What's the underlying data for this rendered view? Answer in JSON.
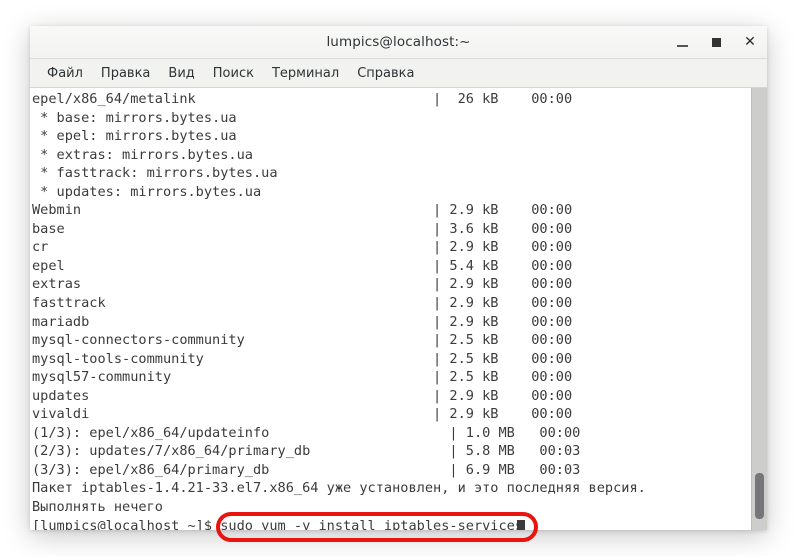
{
  "window": {
    "title": "lumpics@localhost:~",
    "controls": [
      {
        "name": "minimize",
        "glyph": "_"
      },
      {
        "name": "maximize",
        "glyph": "■"
      },
      {
        "name": "close",
        "glyph": "✕"
      }
    ]
  },
  "menubar": {
    "items": [
      {
        "label": "Файл"
      },
      {
        "label": "Правка"
      },
      {
        "label": "Вид"
      },
      {
        "label": "Поиск"
      },
      {
        "label": "Терминал"
      },
      {
        "label": "Справка"
      }
    ]
  },
  "terminal": {
    "lines": [
      "epel/x86_64/metalink                             |  26 kB    00:00",
      " * base: mirrors.bytes.ua",
      " * epel: mirrors.bytes.ua",
      " * extras: mirrors.bytes.ua",
      " * fasttrack: mirrors.bytes.ua",
      " * updates: mirrors.bytes.ua",
      "Webmin                                           | 2.9 kB    00:00",
      "base                                             | 3.6 kB    00:00",
      "cr                                               | 2.9 kB    00:00",
      "epel                                             | 5.4 kB    00:00",
      "extras                                           | 2.9 kB    00:00",
      "fasttrack                                        | 2.9 kB    00:00",
      "mariadb                                          | 2.9 kB    00:00",
      "mysql-connectors-community                       | 2.5 kB    00:00",
      "mysql-tools-community                            | 2.5 kB    00:00",
      "mysql57-community                                | 2.5 kB    00:00",
      "updates                                          | 2.9 kB    00:00",
      "vivaldi                                          | 2.9 kB    00:00",
      "(1/3): epel/x86_64/updateinfo                      | 1.0 MB   00:00",
      "(2/3): updates/7/x86_64/primary_db                 | 5.8 MB   00:03",
      "(3/3): epel/x86_64/primary_db                      | 6.9 MB   00:03",
      "Пакет iptables-1.4.21-33.el7.x86_64 уже установлен, и это последняя версия.",
      "Выполнять нечего",
      "[lumpics@localhost ~]$ sudo yum -y install iptables-services"
    ],
    "prompt": "[lumpics@localhost ~]$",
    "command": "sudo yum -y install iptables-services",
    "cursor": "block"
  },
  "annotation": {
    "highlight_color": "#e8150f",
    "highlight_target": "sudo yum -y install iptables-services"
  }
}
